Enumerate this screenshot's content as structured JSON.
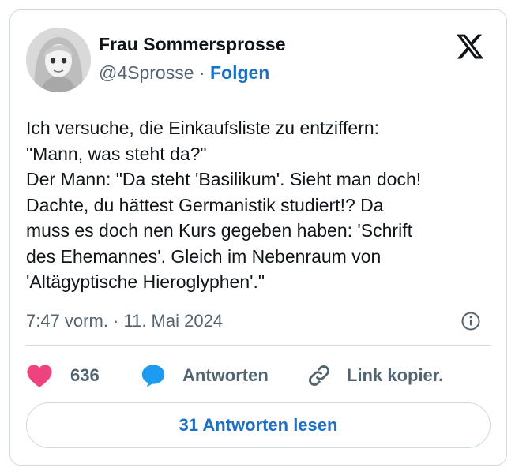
{
  "tweet": {
    "author_name": "Frau Sommersprosse",
    "handle": "@4Sprosse",
    "separator": "·",
    "follow_label": "Folgen",
    "text_lines": [
      "Ich versuche, die Einkaufsliste zu entziffern:",
      "\"Mann, was steht da?\"",
      "Der Mann: \"Da steht 'Basilikum'. Sieht man doch!",
      "Dachte, du hättest Germanistik studiert!? Da",
      "muss es doch nen Kurs gegeben haben: 'Schrift",
      "des Ehemannes'. Gleich im Nebenraum von",
      "'Altägyptische Hieroglyphen'.\""
    ],
    "timestamp": "7:47 vorm. · 11. Mai 2024"
  },
  "actions": {
    "like_count": "636",
    "reply_label": "Antworten",
    "copy_label": "Link kopier."
  },
  "read_replies_label": "31 Antworten lesen",
  "icons": {
    "logo": "x-logo-icon",
    "info": "info-icon",
    "like": "heart-icon",
    "reply": "speech-bubble-icon",
    "copy": "link-icon"
  },
  "colors": {
    "accent": "#1d70c4",
    "heart": "#f0427f",
    "reply_bubble": "#1d9bf0",
    "muted_text": "#536471",
    "border": "#cfd9de"
  }
}
